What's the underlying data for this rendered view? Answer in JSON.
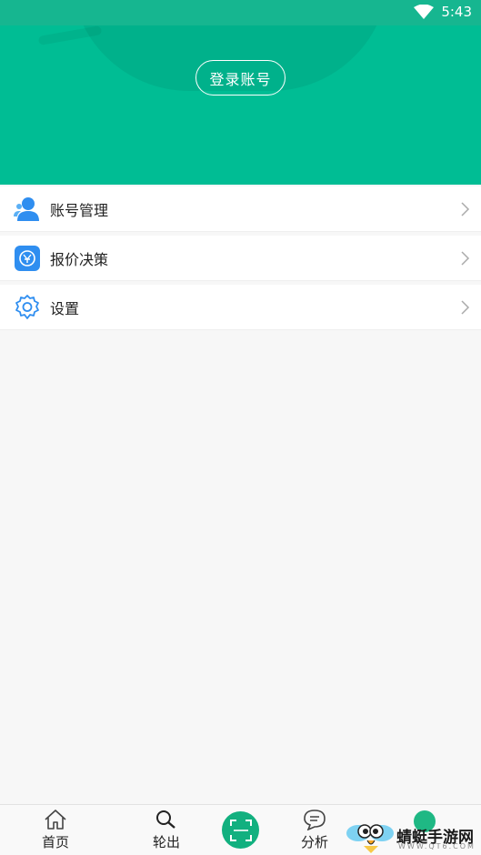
{
  "status_bar": {
    "time": "5:43"
  },
  "header": {
    "login_label": "登录账号",
    "bg_color": "#00bd94"
  },
  "menu": {
    "items": [
      {
        "label": "账号管理",
        "icon": "user-account-icon"
      },
      {
        "label": "报价决策",
        "icon": "quote-decision-icon"
      },
      {
        "label": "设置",
        "icon": "gear-icon"
      }
    ]
  },
  "tabbar": {
    "tabs": [
      {
        "label": "首页",
        "icon": "home-icon"
      },
      {
        "label": "轮出",
        "icon": "search-icon"
      },
      {
        "label": "",
        "icon": "scan-icon"
      },
      {
        "label": "分析",
        "icon": "chat-icon"
      }
    ],
    "accent_color": "#12b07f"
  },
  "watermark": {
    "text": "蜻蜓手游网",
    "url": "WWW.QT6.COM"
  }
}
